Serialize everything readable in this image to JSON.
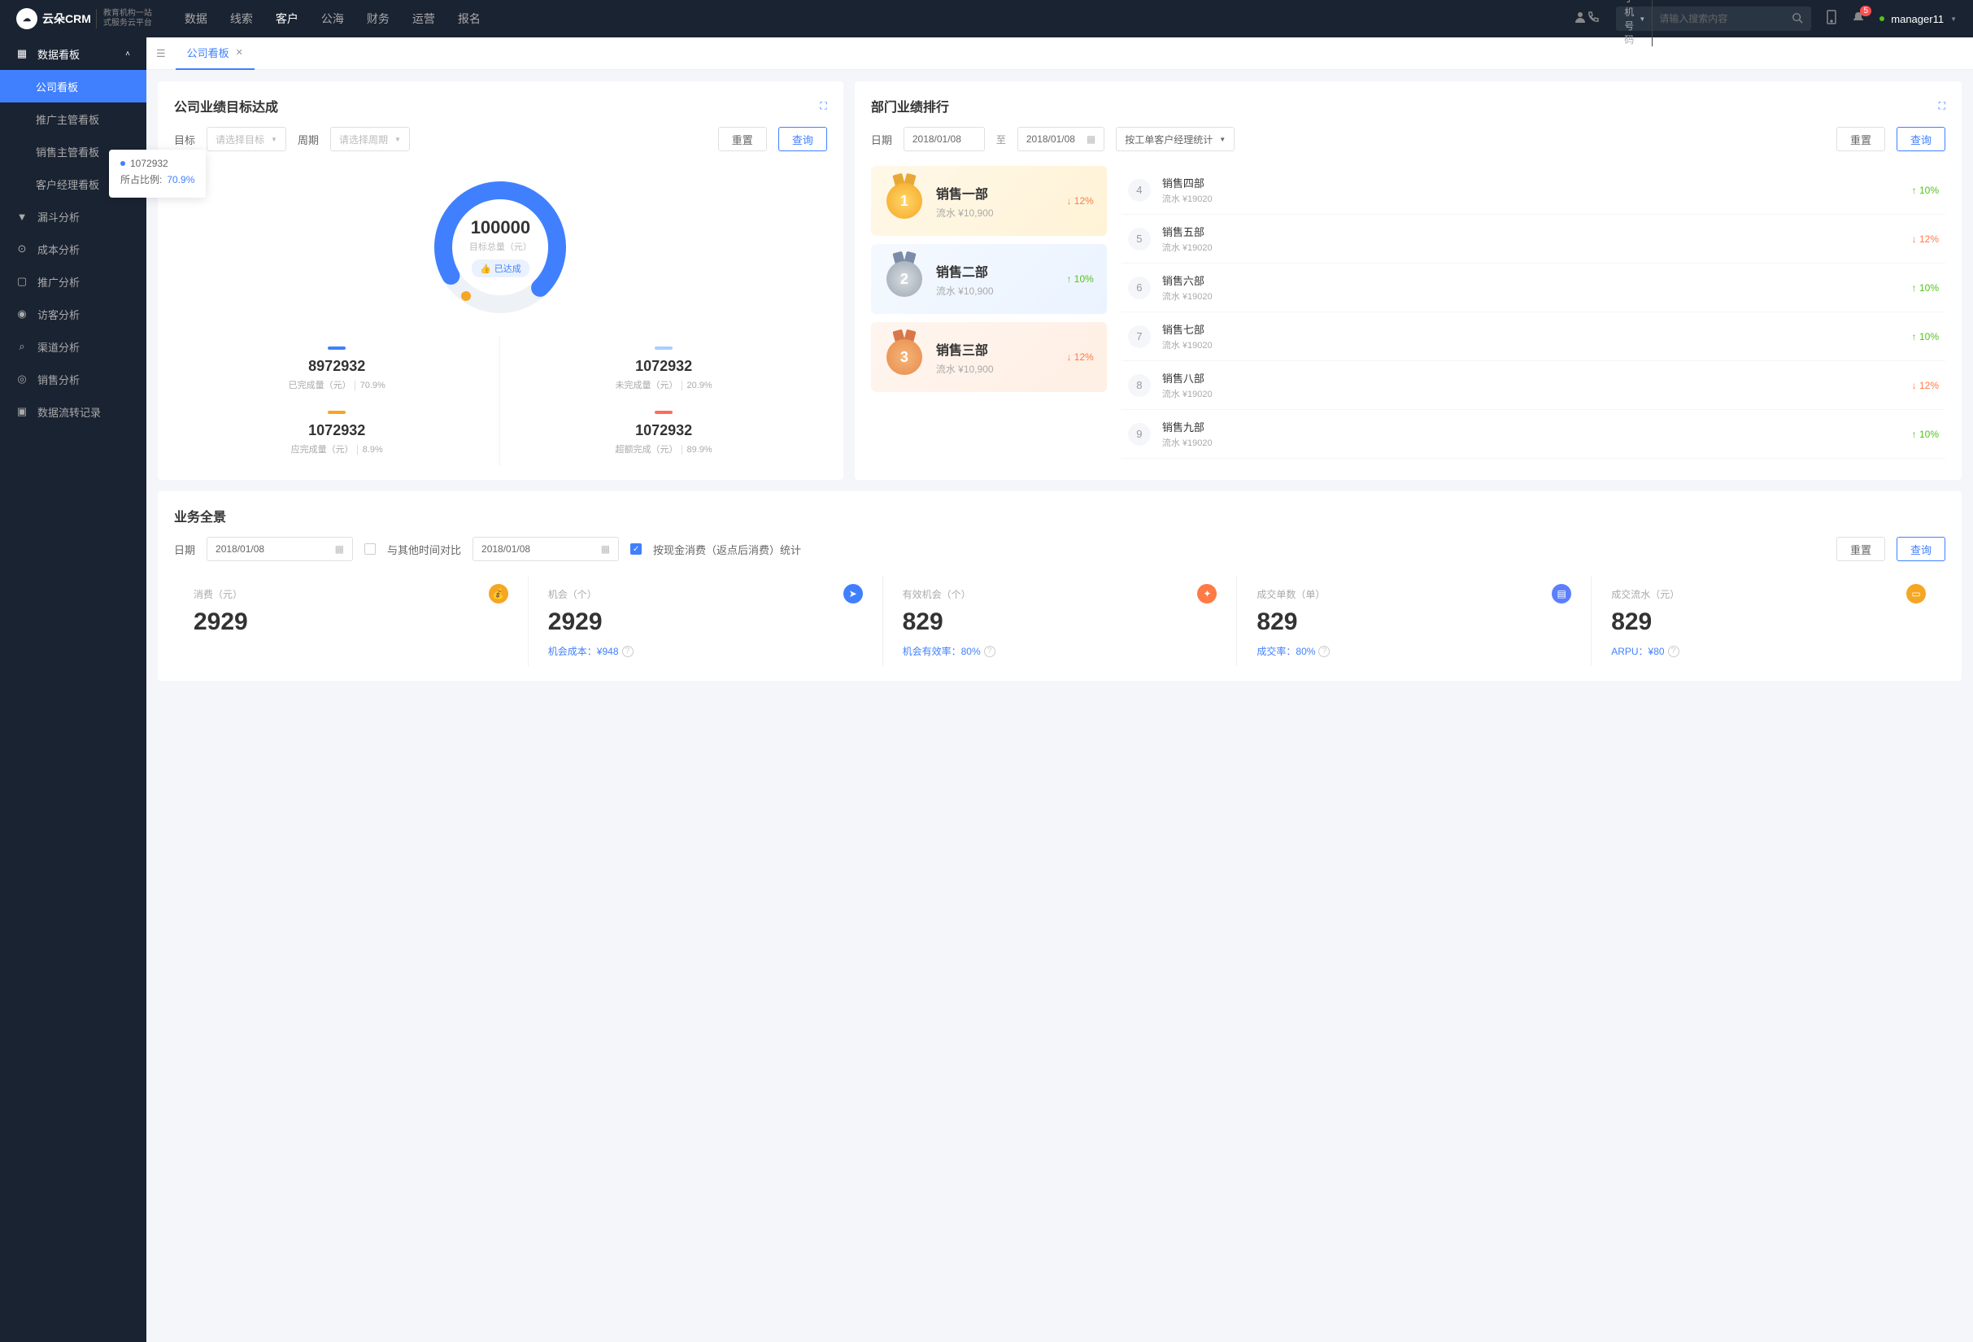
{
  "brand": {
    "name": "云朵CRM",
    "sub1": "教育机构一站",
    "sub2": "式服务云平台"
  },
  "nav": [
    "数据",
    "线索",
    "客户",
    "公海",
    "财务",
    "运营",
    "报名"
  ],
  "nav_active": 2,
  "search": {
    "type": "手机号码",
    "placeholder": "请输入搜索内容"
  },
  "notif_count": "5",
  "user": "manager11",
  "sidebar": {
    "group": "数据看板",
    "subs": [
      "公司看板",
      "推广主管看板",
      "销售主管看板",
      "客户经理看板"
    ],
    "items": [
      "漏斗分析",
      "成本分析",
      "推广分析",
      "访客分析",
      "渠道分析",
      "销售分析",
      "数据流转记录"
    ]
  },
  "tab": "公司看板",
  "gauge": {
    "title": "公司业绩目标达成",
    "target_label": "目标",
    "target_ph": "请选择目标",
    "period_label": "周期",
    "period_ph": "请选择周期",
    "reset": "重置",
    "query": "查询",
    "total": "100000",
    "total_label": "目标总量（元）",
    "badge": "已达成",
    "tooltip_val": "1072932",
    "tooltip_label": "所占比例:",
    "tooltip_pct": "70.9%",
    "stats": [
      {
        "color": "#4080ff",
        "num": "8972932",
        "label": "已完成量（元）",
        "pct": "70.9%"
      },
      {
        "color": "#a8cfff",
        "num": "1072932",
        "label": "未完成量（元）",
        "pct": "20.9%"
      },
      {
        "color": "#f5a623",
        "num": "1072932",
        "label": "应完成量（元）",
        "pct": "8.9%"
      },
      {
        "color": "#ff6b5b",
        "num": "1072932",
        "label": "超额完成（元）",
        "pct": "89.9%"
      }
    ]
  },
  "rank": {
    "title": "部门业绩排行",
    "date_label": "日期",
    "date_from": "2018/01/08",
    "date_to": "2018/01/08",
    "sep": "至",
    "grouping": "按工单客户经理统计",
    "reset": "重置",
    "query": "查询",
    "podium": [
      {
        "rank": "1",
        "name": "销售一部",
        "sub": "流水 ¥10,900",
        "change": "12%",
        "dir": "down"
      },
      {
        "rank": "2",
        "name": "销售二部",
        "sub": "流水 ¥10,900",
        "change": "10%",
        "dir": "up"
      },
      {
        "rank": "3",
        "name": "销售三部",
        "sub": "流水 ¥10,900",
        "change": "12%",
        "dir": "down"
      }
    ],
    "list": [
      {
        "rank": "4",
        "name": "销售四部",
        "sub": "流水 ¥19020",
        "change": "10%",
        "dir": "up"
      },
      {
        "rank": "5",
        "name": "销售五部",
        "sub": "流水 ¥19020",
        "change": "12%",
        "dir": "down"
      },
      {
        "rank": "6",
        "name": "销售六部",
        "sub": "流水 ¥19020",
        "change": "10%",
        "dir": "up"
      },
      {
        "rank": "7",
        "name": "销售七部",
        "sub": "流水 ¥19020",
        "change": "10%",
        "dir": "up"
      },
      {
        "rank": "8",
        "name": "销售八部",
        "sub": "流水 ¥19020",
        "change": "12%",
        "dir": "down"
      },
      {
        "rank": "9",
        "name": "销售九部",
        "sub": "流水 ¥19020",
        "change": "10%",
        "dir": "up"
      }
    ]
  },
  "overview": {
    "title": "业务全景",
    "date_label": "日期",
    "date1": "2018/01/08",
    "compare_label": "与其他时间对比",
    "date2": "2018/01/08",
    "cash_label": "按现金消费（返点后消费）统计",
    "reset": "重置",
    "query": "查询",
    "kpis": [
      {
        "label": "消费（元）",
        "icon": "💰",
        "color": "#f5a623",
        "val": "2929",
        "sub": ""
      },
      {
        "label": "机会（个）",
        "icon": "➤",
        "color": "#4080ff",
        "val": "2929",
        "sub": "机会成本：¥948"
      },
      {
        "label": "有效机会（个）",
        "icon": "✦",
        "color": "#ff7a45",
        "val": "829",
        "sub": "机会有效率：80%"
      },
      {
        "label": "成交单数（单）",
        "icon": "▤",
        "color": "#5b7fff",
        "val": "829",
        "sub": "成交率：80%"
      },
      {
        "label": "成交流水（元）",
        "icon": "▭",
        "color": "#f5a623",
        "val": "829",
        "sub": "ARPU：¥80"
      }
    ]
  },
  "chart_data": {
    "type": "pie",
    "title": "公司业绩目标达成",
    "total": 100000,
    "series": [
      {
        "name": "已完成量（元）",
        "value": 8972932,
        "pct": 70.9
      },
      {
        "name": "未完成量（元）",
        "value": 1072932,
        "pct": 20.9
      },
      {
        "name": "应完成量（元）",
        "value": 1072932,
        "pct": 8.9
      },
      {
        "name": "超额完成（元）",
        "value": 1072932,
        "pct": 89.9
      }
    ]
  }
}
